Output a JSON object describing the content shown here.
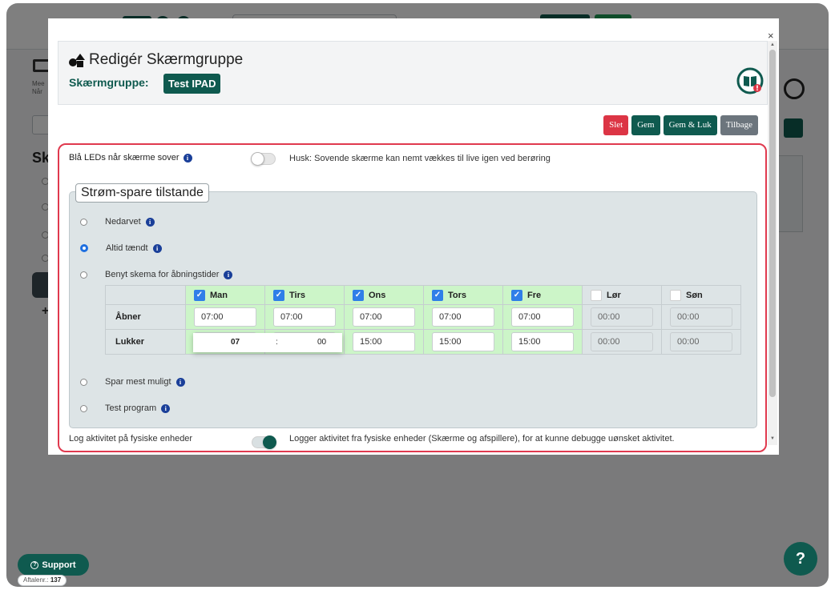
{
  "modal": {
    "title": "Redigér Skærmgruppe",
    "group_label": "Skærmgruppe:",
    "group_name": "Test IPAD",
    "close_glyph": "×"
  },
  "actions": {
    "delete": "Slet",
    "save": "Gem",
    "save_close": "Gem & Luk",
    "back": "Tilbage"
  },
  "settings": {
    "blue_leds": {
      "label": "Blå LEDs når skærme sover",
      "enabled": false,
      "hint": "Husk: Sovende skærme kan nemt vækkes til live igen ved berøring"
    },
    "log_activity": {
      "label": "Log aktivitet på fysiske enheder",
      "enabled": true,
      "hint": "Logger aktivitet fra fysiske enheder (Skærme og afspillere), for at kunne debugge uønsket aktivitet."
    }
  },
  "power_modes": {
    "legend": "Strøm-spare tilstande",
    "options": [
      {
        "label": "Nedarvet",
        "selected": false
      },
      {
        "label": "Altid tændt",
        "selected": true
      },
      {
        "label": "Benyt skema for åbningstider",
        "selected": false
      },
      {
        "label": "Spar mest muligt",
        "selected": false
      },
      {
        "label": "Test program",
        "selected": false
      }
    ]
  },
  "schedule": {
    "days": [
      {
        "name": "Man",
        "checked": true,
        "opens": "07:00",
        "closes": ""
      },
      {
        "name": "Tirs",
        "checked": true,
        "opens": "07:00",
        "closes": ""
      },
      {
        "name": "Ons",
        "checked": true,
        "opens": "07:00",
        "closes": "15:00"
      },
      {
        "name": "Tors",
        "checked": true,
        "opens": "07:00",
        "closes": "15:00"
      },
      {
        "name": "Fre",
        "checked": true,
        "opens": "07:00",
        "closes": "15:00"
      },
      {
        "name": "Lør",
        "checked": false,
        "opens": "00:00",
        "closes": "00:00"
      },
      {
        "name": "Søn",
        "checked": false,
        "opens": "00:00",
        "closes": "00:00"
      }
    ],
    "row_opens": "Åbner",
    "row_closes": "Lukker",
    "time_picker": {
      "hour": "07",
      "separator": ":",
      "minute": "00"
    }
  },
  "footer": {
    "support_label": "Support",
    "agreement_prefix": "Aftalenr.:",
    "agreement_number": "137",
    "help_glyph": "?"
  },
  "background": {
    "heading": "Sk",
    "small_text_1": "Mee",
    "small_text_2": "Når"
  },
  "colors": {
    "brand": "#0f5a4f",
    "danger": "#dc3545",
    "highlight": "#e0394e",
    "enabled_day": "#ccf5c8",
    "info": "#1a3f99"
  }
}
